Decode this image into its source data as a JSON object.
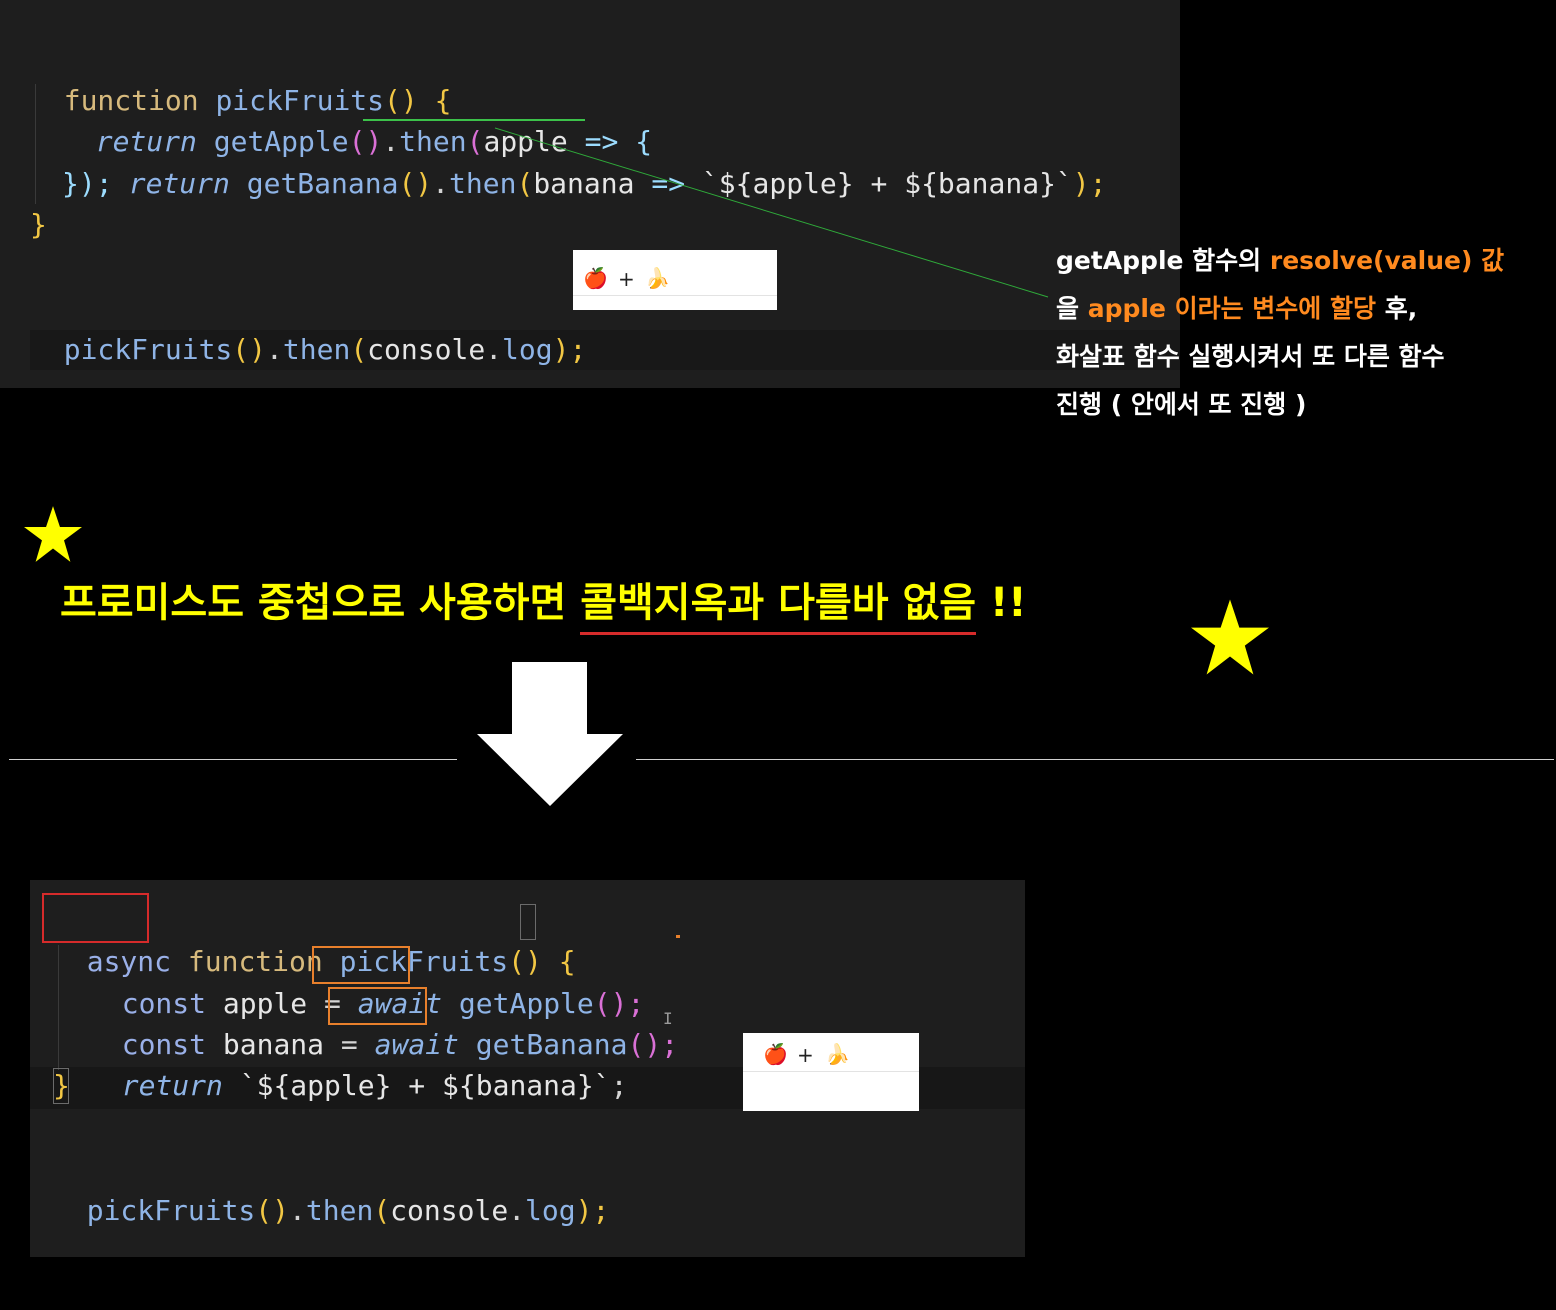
{
  "top_code": {
    "line1": {
      "kw": "function",
      "fn": "pickFruits",
      "p": "()",
      "b": "{"
    },
    "line2": {
      "ret": "return",
      "call": "getApple",
      "p1": "()",
      "dot": ".",
      "then": "then",
      "p2": "(",
      "arg": "apple",
      "arrow": "=>",
      "b": "{"
    },
    "line3": {
      "ret": "return",
      "call": "getBanana",
      "p1": "()",
      "dot": ".",
      "then": "then",
      "p2": "(",
      "arg": "banana",
      "arrow": "=>",
      "tpl": "`${apple} + ${banana}`",
      "end": ");"
    },
    "line4": "});",
    "line5": "}",
    "line6": {
      "call": "pickFruits",
      "p": "()",
      "dot": ".",
      "then": "then",
      "p2": "(",
      "obj": "console",
      "dot2": ".",
      "m": "log",
      "end": ");"
    }
  },
  "top_output": {
    "apple": "🍎",
    "plus": "+",
    "banana": "🍌"
  },
  "annotation": {
    "l1_a": "getApple 함수의 ",
    "l1_b": "resolve(value) 값",
    "l2_a": "을 ",
    "l2_b": "apple 이라는 변수에 할당",
    "l2_c": " 후,",
    "l3": "화살표 함수 실행시켜서 또 다른 함수",
    "l4": "진행 ( 안에서 또 진행 )"
  },
  "headline": {
    "a": "프로미스도 중첩으로 사용하면 ",
    "b": "콜백지옥과 다를바 없음",
    "c": " !!"
  },
  "star_glyph": "★",
  "arrow_glyph": "down-arrow",
  "bottom_code": {
    "line1": {
      "async": "async",
      "kw": "function",
      "fn": "pickFruits",
      "p": "()",
      "b": "{"
    },
    "line2": {
      "kw": "const",
      "id": "apple",
      "eq": "=",
      "aw": "await",
      "call": "getApple",
      "end": "();"
    },
    "line3": {
      "kw": "const",
      "id": "banana",
      "eq": "=",
      "aw": "await",
      "call": "getBanana",
      "end": "();"
    },
    "line4": {
      "ret": "return",
      "tpl": "`${apple} + ${banana}`",
      "end": ";"
    },
    "line5": "}",
    "line6": {
      "call": "pickFruits",
      "p": "()",
      "dot": ".",
      "then": "then",
      "p2": "(",
      "obj": "console",
      "dot2": ".",
      "m": "log",
      "end": ");"
    }
  },
  "bottom_output": {
    "apple": "🍎",
    "plus": "+",
    "banana": "🍌"
  },
  "cursor_glyph": "I"
}
